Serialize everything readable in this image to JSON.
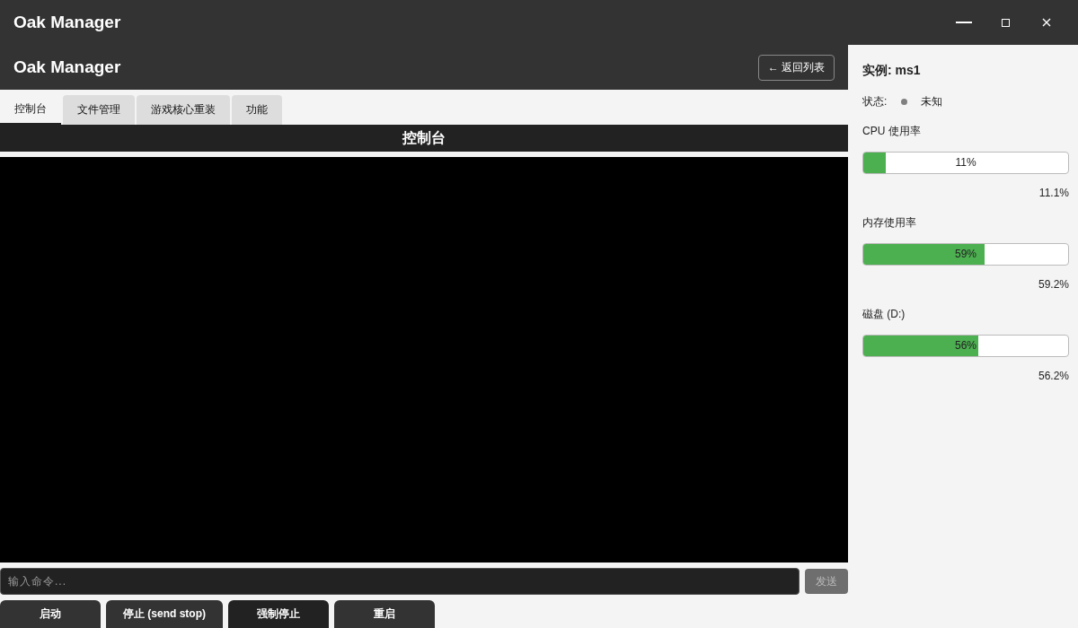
{
  "window": {
    "title": "Oak Manager"
  },
  "header": {
    "title": "Oak Manager",
    "back_button": "← 返回列表"
  },
  "tabs": [
    {
      "label": "控制台",
      "selected": true
    },
    {
      "label": "文件管理",
      "selected": false
    },
    {
      "label": "游戏核心重装",
      "selected": false
    },
    {
      "label": "功能",
      "selected": false
    }
  ],
  "console": {
    "title": "控制台",
    "input": {
      "placeholder": "输入命令..."
    },
    "send_button": {
      "label": "发送",
      "disabled": true
    }
  },
  "actions": [
    "启动",
    "停止 (send stop)",
    "强制停止",
    "重启"
  ],
  "instance": {
    "title": "实例: ms1",
    "status": {
      "label": "状态:",
      "value": "未知",
      "color": "#808080"
    }
  },
  "meters": [
    {
      "label": "CPU 使用率",
      "level": 0.111,
      "bar_text": "11%",
      "reading": "11.1%"
    },
    {
      "label": "内存使用率",
      "level": 0.592,
      "bar_text": "59%",
      "reading": "59.2%"
    },
    {
      "label": "磁盘 (D:)",
      "level": 0.562,
      "bar_text": "56%",
      "reading": "56.2%"
    }
  ]
}
